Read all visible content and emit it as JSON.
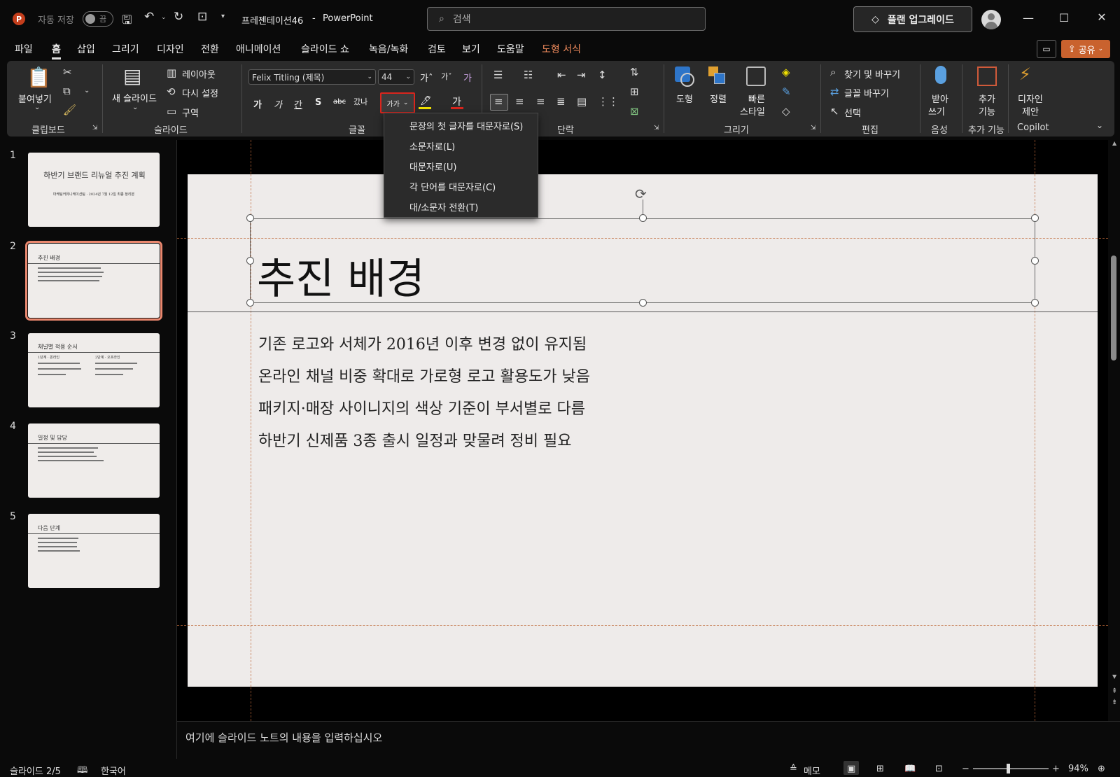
{
  "titlebar": {
    "autosave_label": "자동 저장",
    "autosave_state": "끔",
    "doc_title": "프레젠테이션46",
    "separator": "-",
    "app_name": "PowerPoint",
    "search_placeholder": "검색",
    "upgrade_label": "플랜 업그레이드"
  },
  "tabs": [
    "파일",
    "홈",
    "삽입",
    "그리기",
    "디자인",
    "전환",
    "애니메이션",
    "슬라이드 쇼",
    "녹음/녹화",
    "검토",
    "보기",
    "도움말",
    "도형 서식"
  ],
  "active_tab": "홈",
  "share_label": "공유",
  "ribbon": {
    "clipboard": {
      "paste": "붙여넣기",
      "group": "클립보드"
    },
    "slides": {
      "new_slide_1": "새 슬라이드",
      "layout": "레이아웃",
      "reset": "다시 설정",
      "section": "구역",
      "group": "슬라이드"
    },
    "font": {
      "font_name": "Felix Titling (제목)",
      "font_size": "44",
      "case_btn": "가가",
      "group": "글꼴",
      "bold": "가",
      "italic": "가",
      "underline": "간",
      "shadow": "S",
      "strike": "abc",
      "spacing": "갔나",
      "grow": "가ˆ",
      "shrink": "가ˇ",
      "clear": "가",
      "highlight": "🖊",
      "font_color": "가"
    },
    "paragraph": {
      "group": "단락"
    },
    "drawing": {
      "shapes": "도형",
      "arrange": "정렬",
      "quick_1": "빠른",
      "quick_2": "스타일",
      "group": "그리기"
    },
    "editing": {
      "find": "찾기 및 바꾸기",
      "replace": "글꼴 바꾸기",
      "select": "선택",
      "group": "편집"
    },
    "voice": {
      "dictate_1": "받아",
      "dictate_2": "쓰기",
      "group": "음성"
    },
    "addins": {
      "label_1": "추가",
      "label_2": "기능",
      "group": "추가 기능"
    },
    "designer": {
      "label_1": "디자인",
      "label_2": "제안",
      "group": "Copilot"
    }
  },
  "case_menu": [
    "문장의 첫 글자를 대문자로(S)",
    "소문자로(L)",
    "대문자로(U)",
    "각 단어를 대문자로(C)",
    "대/소문자 전환(T)"
  ],
  "thumbnails": [
    {
      "num": "1",
      "title": "하반기 브랜드 리뉴얼 추진 계획",
      "subtitle": "마케팅커뮤니케이션팀 · 2024년 7월 12일 최종 정리본"
    },
    {
      "num": "2",
      "title": "추진 배경"
    },
    {
      "num": "3",
      "title": "채널별 적용 순서",
      "col1_1": "1단계 · 온라인",
      "col2_1": "2단계 · 오프라인"
    },
    {
      "num": "4",
      "title": "일정 및 담당"
    },
    {
      "num": "5",
      "title": "다음 단계"
    }
  ],
  "slide": {
    "title": "추진 배경",
    "bullets": [
      "기존 로고와 서체가 2016년 이후 변경 없이 유지됨",
      "온라인 채널 비중 확대로 가로형 로고 활용도가 낮음",
      "패키지·매장 사이니지의 색상 기준이 부서별로 다름",
      "하반기 신제품 3종 출시 일정과 맞물려 정비 필요"
    ]
  },
  "notes_placeholder": "여기에 슬라이드 노트의 내용을 입력하십시오",
  "status": {
    "slide_info": "슬라이드 2/5",
    "language": "한국어",
    "notes_btn": "메모",
    "zoom": "94%"
  },
  "colors": {
    "accent": "#c9622e",
    "selection_border": "#d9251d",
    "thumb_selected": "#e9876e",
    "context_tab": "#ef8a5c"
  }
}
